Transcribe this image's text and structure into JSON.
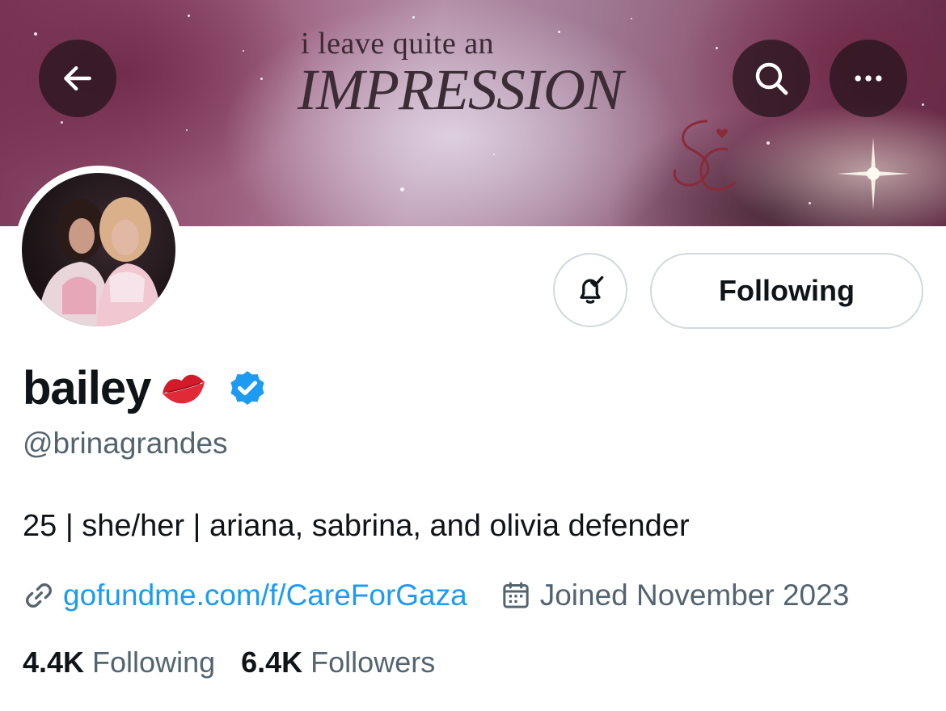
{
  "banner": {
    "line1": "i leave quite an",
    "line2": "IMPRESSION"
  },
  "header": {
    "back_icon": "arrow-left-icon",
    "search_icon": "search-icon",
    "more_icon": "more-horizontal-icon"
  },
  "actions": {
    "notification_icon": "bell-check-icon",
    "follow_label": "Following"
  },
  "profile": {
    "display_name": "bailey",
    "name_emoji": "kiss-mark-icon",
    "verified_icon": "verified-badge-icon",
    "handle": "@brinagrandes",
    "bio": "25 | she/her | ariana, sabrina, and olivia defender",
    "link_icon": "link-icon",
    "link": "gofundme.com/f/CareForGaza",
    "joined_icon": "calendar-icon",
    "joined": "Joined November 2023"
  },
  "stats": {
    "following_count": "4.4K",
    "following_label": "Following",
    "followers_count": "6.4K",
    "followers_label": "Followers"
  },
  "colors": {
    "accent": "#1d9bf0",
    "secondary_text": "#536471",
    "border": "#cfd9de"
  }
}
